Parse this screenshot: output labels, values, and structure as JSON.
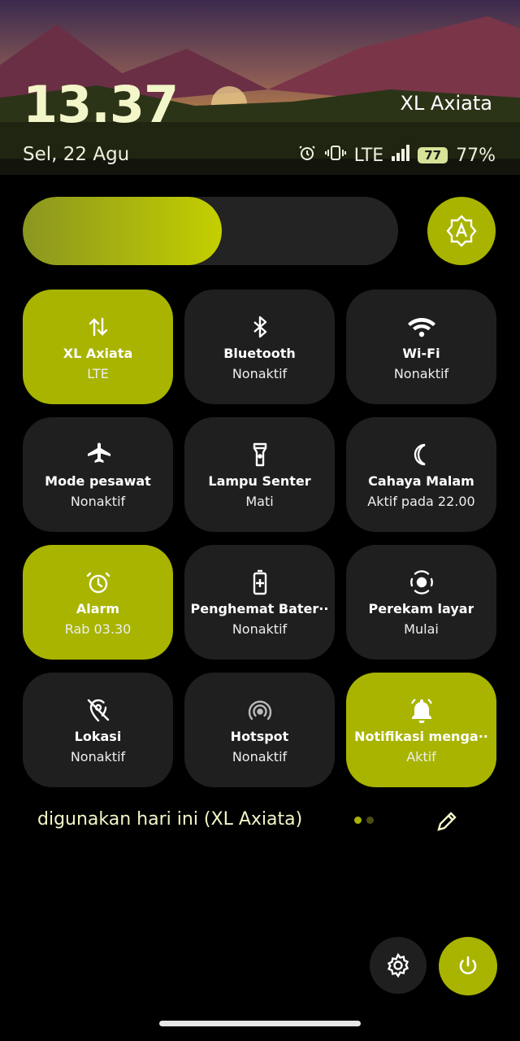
{
  "header": {
    "time": "13.37",
    "carrier": "XL Axiata",
    "date": "Sel, 22 Agu",
    "network_type": "LTE",
    "battery_badge": "77",
    "battery_percent": "77%",
    "icons": [
      "alarm-icon",
      "vibrate-icon",
      "signal-icon",
      "battery-icon"
    ]
  },
  "brightness": {
    "level": 0.53,
    "auto_icon": "auto-brightness-icon"
  },
  "tiles": [
    {
      "label": "XL Axiata",
      "sub": "LTE",
      "icon": "mobile-data-icon",
      "active": true
    },
    {
      "label": "Bluetooth",
      "sub": "Nonaktif",
      "icon": "bluetooth-icon",
      "active": false
    },
    {
      "label": "Wi-Fi",
      "sub": "Nonaktif",
      "icon": "wifi-icon",
      "active": false
    },
    {
      "label": "Mode pesawat",
      "sub": "Nonaktif",
      "icon": "airplane-icon",
      "active": false
    },
    {
      "label": "Lampu Senter",
      "sub": "Mati",
      "icon": "flashlight-icon",
      "active": false
    },
    {
      "label": "Cahaya Malam",
      "sub": "Aktif pada 22.00",
      "icon": "moon-icon",
      "active": false
    },
    {
      "label": "Alarm",
      "sub": "Rab 03.30",
      "icon": "alarm-icon",
      "active": true
    },
    {
      "label": "Penghemat Bater··",
      "sub": "Nonaktif",
      "icon": "battery-saver-icon",
      "active": false
    },
    {
      "label": "Perekam layar",
      "sub": "Mulai",
      "icon": "screen-record-icon",
      "active": false
    },
    {
      "label": "Lokasi",
      "sub": "Nonaktif",
      "icon": "location-off-icon",
      "active": false
    },
    {
      "label": "Hotspot",
      "sub": "Nonaktif",
      "icon": "hotspot-icon",
      "active": false
    },
    {
      "label": "Notifikasi menga··",
      "sub": "Aktif",
      "icon": "bell-icon",
      "active": true
    }
  ],
  "footer": {
    "usage_text": "digunakan hari ini (XL Axiata)",
    "page_dots": 2,
    "active_page": 1
  },
  "colors": {
    "accent": "#a8b400",
    "tile": "#1f1f1f",
    "background": "#000000"
  }
}
